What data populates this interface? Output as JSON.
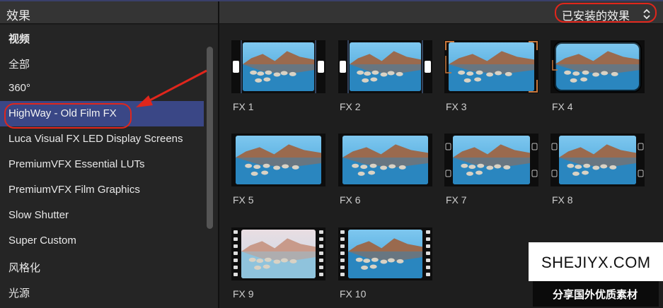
{
  "left_panel": {
    "title": "效果",
    "categories": [
      {
        "label": "视频",
        "heading": true
      },
      {
        "label": "全部"
      },
      {
        "label": "360°"
      },
      {
        "label": "HighWay - Old Film FX",
        "selected": true
      },
      {
        "label": "Luca Visual FX LED Display Screens"
      },
      {
        "label": "PremiumVFX Essential LUTs"
      },
      {
        "label": "PremiumVFX Film Graphics"
      },
      {
        "label": "Slow Shutter"
      },
      {
        "label": "Super Custom"
      },
      {
        "label": "风格化"
      },
      {
        "label": "光源"
      }
    ]
  },
  "right_panel": {
    "filter_label": "已安装的效果",
    "effects": [
      {
        "label": "FX 1",
        "frame_style": "side-tabs-white"
      },
      {
        "label": "FX 2",
        "frame_style": "side-tabs-white"
      },
      {
        "label": "FX 3",
        "frame_style": "corner-brackets-orange"
      },
      {
        "label": "FX 4",
        "frame_style": "rounded-vignette"
      },
      {
        "label": "FX 5",
        "frame_style": "plain"
      },
      {
        "label": "FX 6",
        "frame_style": "plain"
      },
      {
        "label": "FX 7",
        "frame_style": "sprocket-corners"
      },
      {
        "label": "FX 8",
        "frame_style": "sprocket-corners"
      },
      {
        "label": "FX 9",
        "frame_style": "film-strip-faded"
      },
      {
        "label": "FX 10",
        "frame_style": "film-strip"
      }
    ]
  },
  "watermark": {
    "site": "SHEJIYX.COM",
    "slogan": "分享国外优质素材"
  },
  "colors": {
    "selection": "#3a4786",
    "annotation_red": "#e0261c",
    "sky": "#4fa6d8",
    "mountain": "#9a6a4e"
  },
  "icons": {
    "chevron": "updown-chevron-icon",
    "arrow": "annotation-arrow-icon"
  }
}
